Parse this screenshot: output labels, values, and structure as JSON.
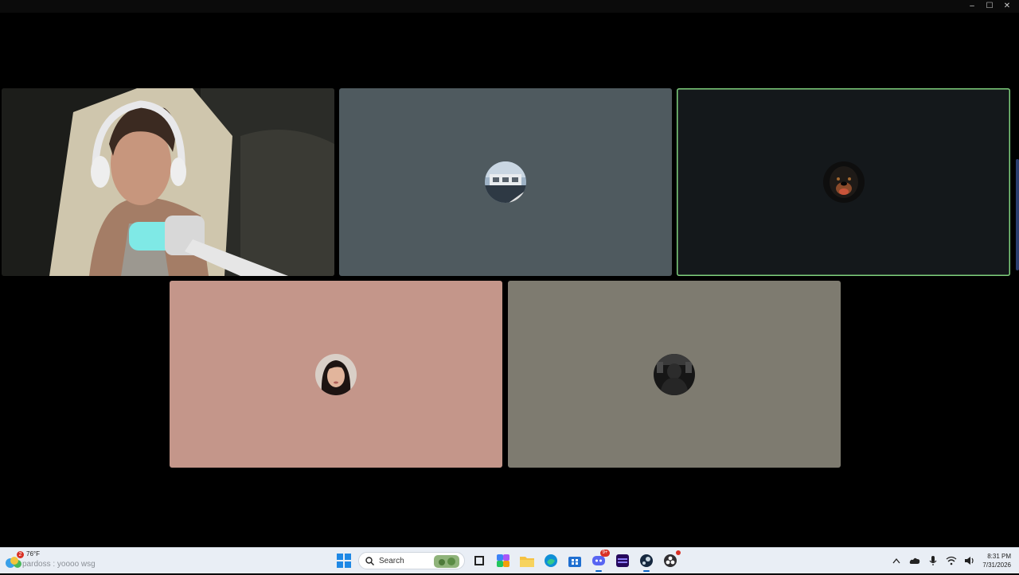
{
  "window": {
    "controls": {
      "minimize": "–",
      "maximize": "☐",
      "close": "✕"
    }
  },
  "call": {
    "tiles": [
      {
        "id": "camera",
        "kind": "video",
        "speaking": false
      },
      {
        "id": "user-2",
        "kind": "avatar",
        "bg": "#4f5a5f",
        "speaking": false,
        "avatar_desc": "building-photo"
      },
      {
        "id": "user-3",
        "kind": "avatar",
        "bg": "#14181b",
        "speaking": true,
        "avatar_desc": "rottweiler-photo"
      },
      {
        "id": "user-4",
        "kind": "avatar",
        "bg": "#c4968a",
        "speaking": false,
        "avatar_desc": "person-photo"
      },
      {
        "id": "user-5",
        "kind": "avatar",
        "bg": "#7e7b70",
        "speaking": false,
        "avatar_desc": "dark-photo"
      }
    ]
  },
  "taskbar": {
    "weather": {
      "temp": "76°F",
      "badge": "2"
    },
    "notification": "pardoss : yoooo wsg",
    "search": {
      "placeholder": "Search"
    },
    "apps": [
      "start-icon",
      "search",
      "widgets-icon",
      "file-explorer-icon",
      "copilot-icon",
      "folder-icon",
      "edge-icon",
      "store-icon",
      "discord-icon",
      "amazon-music-icon",
      "steam-icon",
      "obs-icon"
    ],
    "discord_badge": "9+",
    "clock": {
      "time": "8:31 PM",
      "date": "7/31/2026"
    }
  },
  "colors": {
    "speaking_border": "#7fd07d",
    "taskbar_bg": "#e9eef5",
    "accent": "#0a64c8"
  }
}
